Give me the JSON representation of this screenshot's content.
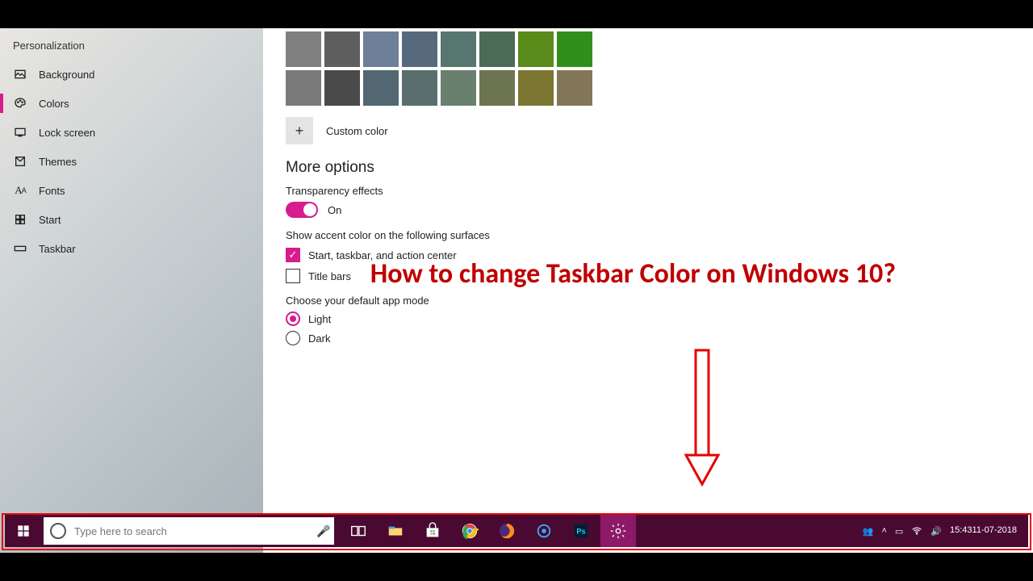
{
  "sidebar": {
    "title": "Personalization",
    "items": [
      {
        "label": "Background"
      },
      {
        "label": "Colors"
      },
      {
        "label": "Lock screen"
      },
      {
        "label": "Themes"
      },
      {
        "label": "Fonts"
      },
      {
        "label": "Start"
      },
      {
        "label": "Taskbar"
      }
    ]
  },
  "colors_row1": [
    "#808080",
    "#5e5e5e",
    "#6d7f99",
    "#56697d",
    "#57766f",
    "#4c6b56",
    "#5a8a1a",
    "#2f8f1a"
  ],
  "colors_row2": [
    "#7a7a7a",
    "#4a4a4a",
    "#536772",
    "#5a6e6e",
    "#69806e",
    "#6d7450",
    "#7a7531",
    "#847757"
  ],
  "custom_color_label": "Custom color",
  "more_options_heading": "More options",
  "transparency_label": "Transparency effects",
  "transparency_state": "On",
  "accent_surfaces_label": "Show accent color on the following surfaces",
  "checkbox_start_label": "Start, taskbar, and action center",
  "checkbox_title_label": "Title bars",
  "app_mode_label": "Choose your default app mode",
  "radio_light": "Light",
  "radio_dark": "Dark",
  "annotation": "How to change Taskbar Color on Windows 10?",
  "search_placeholder": "Type here to search",
  "clock_time": "15:43",
  "clock_date": "11-07-2018"
}
